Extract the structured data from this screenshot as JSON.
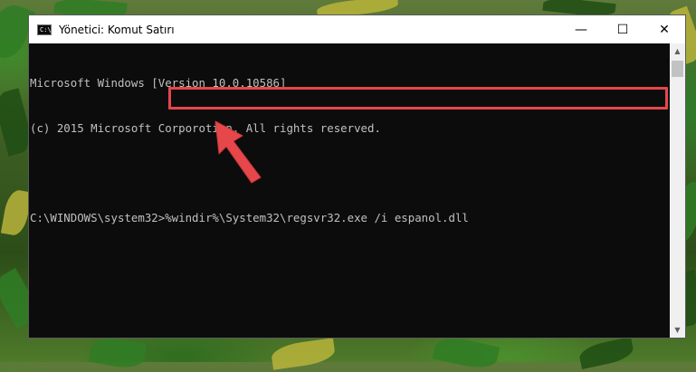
{
  "window": {
    "title": "Yönetici: Komut Satırı",
    "controls": {
      "minimize": "—",
      "maximize": "☐",
      "close": "✕"
    }
  },
  "console": {
    "lines": [
      "Microsoft Windows [Version 10.0.10586]",
      "(c) 2015 Microsoft Corporotion. All rights reserved.",
      "",
      "C:\\WINDOWS\\system32>%windir%\\System32\\regsvr32.exe /i espanol.dll"
    ]
  },
  "colors": {
    "highlight": "#e5474b",
    "arrow": "#e5474b",
    "console_bg": "#0c0c0c",
    "console_text": "#c0c0c0"
  },
  "icons": {
    "app": "cmd-icon",
    "arrow": "red-arrow-icon"
  }
}
